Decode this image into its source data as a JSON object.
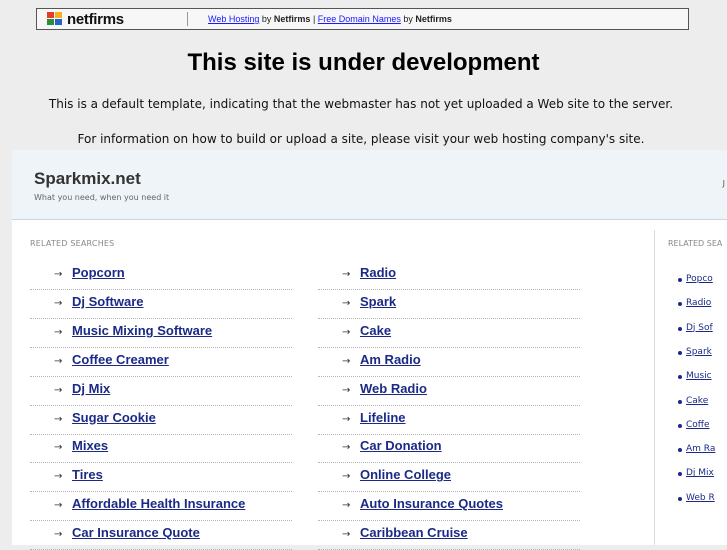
{
  "banner": {
    "logo_text": "netfirms",
    "web_hosting_link": "Web Hosting",
    "by1": "by",
    "brand1": "Netfirms",
    "separator": "|",
    "free_domains_link": "Free Domain Names",
    "by2": "by",
    "brand2": "Netfirms"
  },
  "headline": "This site is under development",
  "info_line_1": "This is a default template, indicating that the webmaster has not yet uploaded a Web site to the server.",
  "info_line_2": "For information on how to build or upload a site, please visit your web hosting company's site.",
  "panel": {
    "site_name": "Sparkmix.net",
    "tagline": "What you need, when you need it",
    "header_right": "J",
    "related_label": "RELATED SEARCHES",
    "side_label": "RELATED SEA",
    "left_links": [
      "Popcorn",
      "Dj Software",
      "Music Mixing Software",
      "Coffee Creamer",
      "Dj Mix",
      "Sugar Cookie",
      "Mixes",
      "Tires",
      "Affordable Health Insurance",
      "Car Insurance Quote"
    ],
    "right_links": [
      "Radio",
      "Spark",
      "Cake",
      "Am Radio",
      "Web Radio",
      "Lifeline",
      "Car Donation",
      "Online College",
      "Auto Insurance Quotes",
      "Caribbean Cruise"
    ],
    "side_links": [
      "Popco",
      "Radio",
      "Dj Sof",
      "Spark",
      "Music",
      "Cake",
      "Coffe",
      "Am Ra",
      "Dj Mix",
      "Web R"
    ]
  },
  "icons": {
    "arrow": "→"
  },
  "colors": {
    "link": "#1b2a86",
    "banner_link": "#1a1aff"
  }
}
